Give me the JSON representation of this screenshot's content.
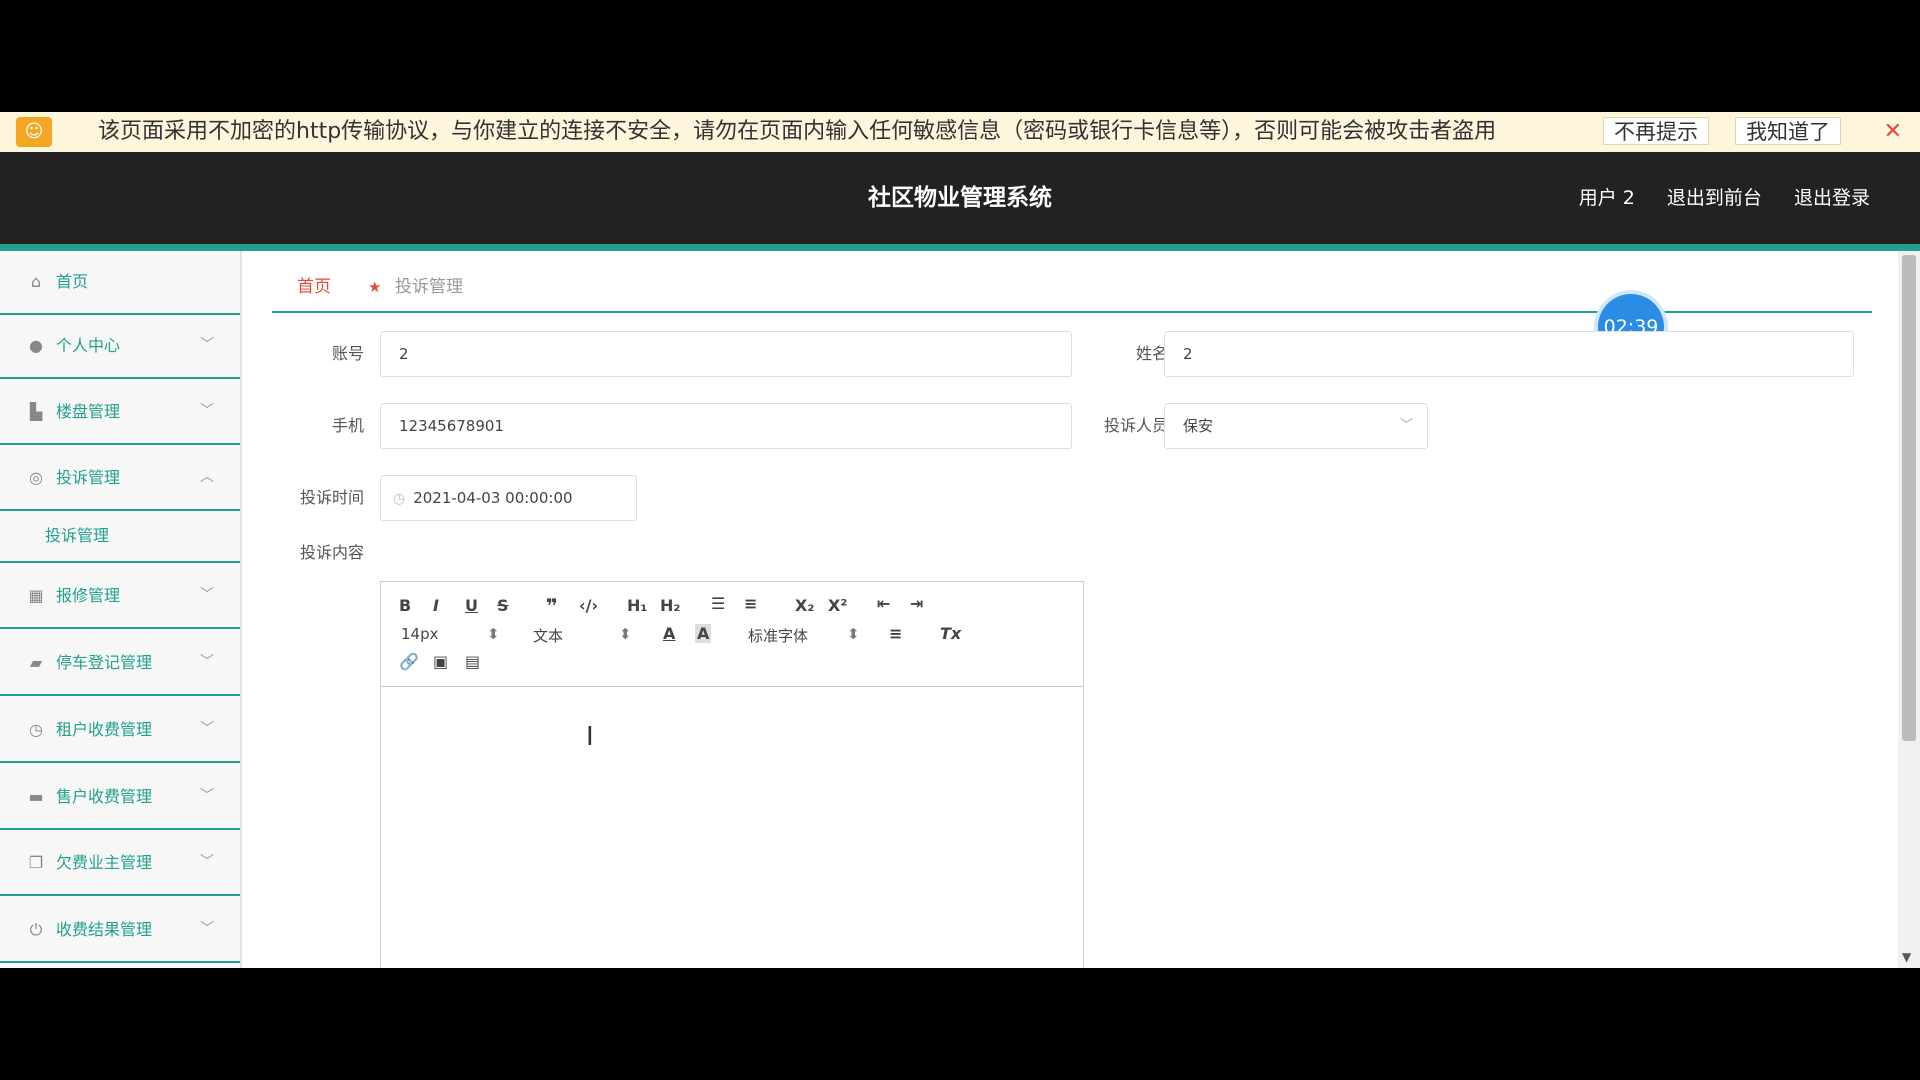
{
  "warning": {
    "message": "该页面采用不加密的http传输协议，与你建立的连接不安全，请勿在页面内输入任何敏感信息（密码或银行卡信息等），否则可能会被攻击者盗用",
    "no_remind": "不再提示",
    "got_it": "我知道了",
    "close": "✕"
  },
  "header": {
    "title": "社区物业管理系统",
    "user": "用户 2",
    "to_front": "退出到前台",
    "logout": "退出登录"
  },
  "sidebar": {
    "items": [
      {
        "label": "首页",
        "icon": "home-icon"
      },
      {
        "label": "个人中心",
        "icon": "user-icon"
      },
      {
        "label": "楼盘管理",
        "icon": "building-icon"
      },
      {
        "label": "投诉管理",
        "icon": "complaint-icon"
      },
      {
        "label": "报修管理",
        "icon": "grid-icon"
      },
      {
        "label": "停车登记管理",
        "icon": "car-icon"
      },
      {
        "label": "租户收费管理",
        "icon": "clock-icon"
      },
      {
        "label": "售户收费管理",
        "icon": "card-icon"
      },
      {
        "label": "欠费业主管理",
        "icon": "copy-icon"
      },
      {
        "label": "收费结果管理",
        "icon": "power-icon"
      }
    ],
    "sub_item": "投诉管理"
  },
  "breadcrumb": {
    "home": "首页",
    "current": "投诉管理"
  },
  "timer": "02:39",
  "form": {
    "account_label": "账号",
    "account_value": "2",
    "name_label": "姓名",
    "name_value": "2",
    "phone_label": "手机",
    "phone_value": "12345678901",
    "target_label": "投诉人员",
    "target_value": "保安",
    "time_label": "投诉时间",
    "time_value": "2021-04-03 00:00:00",
    "content_label": "投诉内容"
  },
  "editor": {
    "font_size": "14px",
    "format": "文本",
    "font_family": "标准字体"
  }
}
